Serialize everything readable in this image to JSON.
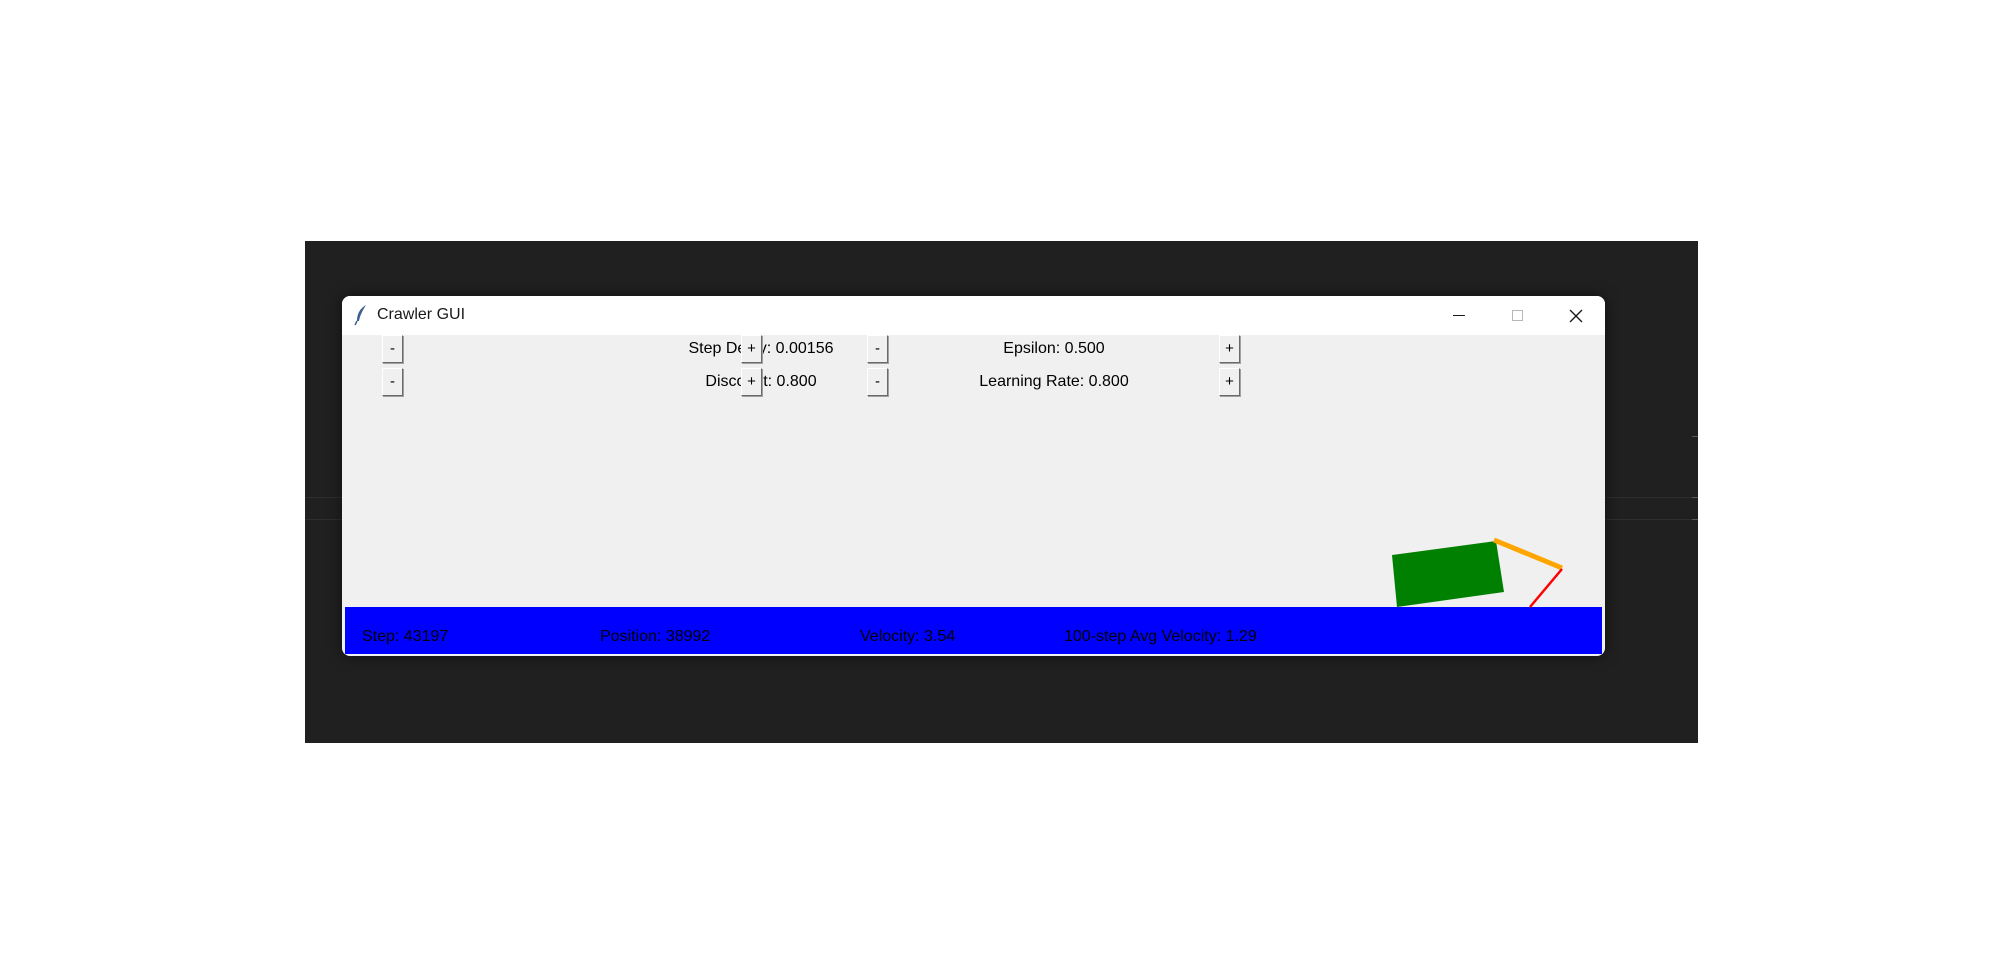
{
  "window": {
    "title": "Crawler GUI",
    "app_icon": "feather-icon",
    "caption_buttons": [
      "minimize-icon",
      "maximize-icon",
      "close-icon"
    ]
  },
  "controls": {
    "step_delay": {
      "label": "Step Delay: 0.00156",
      "decrement": "-",
      "increment": "+"
    },
    "discount": {
      "label": "Discount: 0.800",
      "decrement": "-",
      "increment": "+"
    },
    "epsilon": {
      "label": "Epsilon: 0.500",
      "decrement": "-",
      "increment": "+"
    },
    "learning_rate": {
      "label": "Learning Rate: 0.800",
      "decrement": "-",
      "increment": "+"
    }
  },
  "stats": {
    "step": "Step: 43197",
    "position": "Position: 38992",
    "velocity": "Velocity: 3.54",
    "avg_velocity": "100-step Avg Velocity: 1.29"
  },
  "colors": {
    "ground": "#0000ff",
    "robot_body": "#008000",
    "arm": "#ffa500",
    "hand": "#ff0000",
    "panel": "#f0f0f0",
    "desktop": "#202020"
  }
}
